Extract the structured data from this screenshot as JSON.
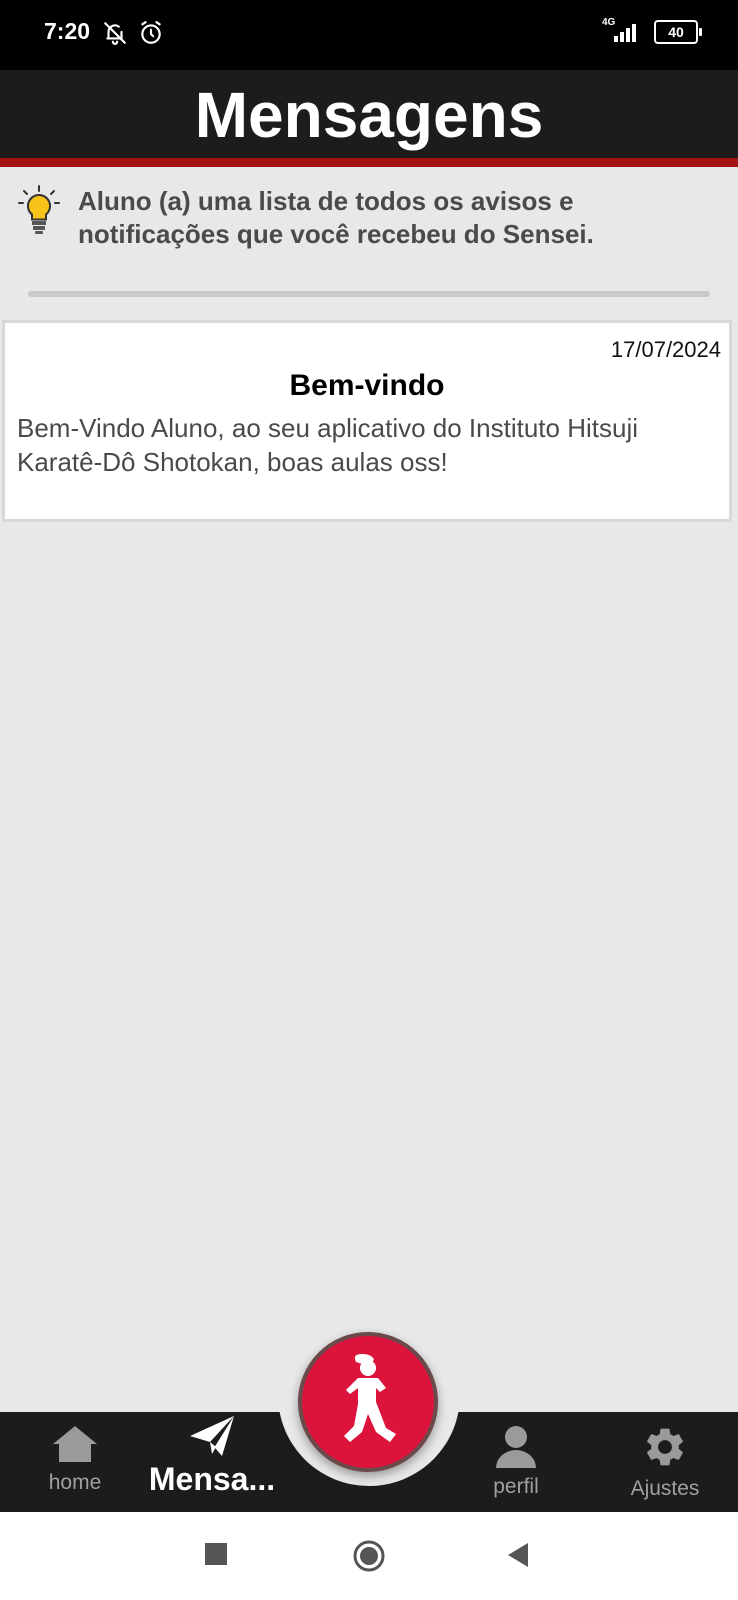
{
  "status_bar": {
    "time": "7:20",
    "network": "4G",
    "battery": "40"
  },
  "header": {
    "title": "Mensagens"
  },
  "info": {
    "text": "Aluno (a) uma lista de todos os avisos e notificações que você recebeu do Sensei."
  },
  "messages": [
    {
      "date": "17/07/2024",
      "title": "Bem-vindo",
      "body": "Bem-Vindo Aluno, ao seu aplicativo do Instituto Hitsuji Karatê-Dô Shotokan, boas aulas oss!"
    }
  ],
  "nav": {
    "home": "home",
    "messages": "Mensa...",
    "profile": "perfil",
    "settings": "Ajustes"
  },
  "colors": {
    "header_bg": "#1c1c1c",
    "accent_red": "#a31313",
    "fab": "#dc143c",
    "page_bg": "#e8e8e8"
  }
}
